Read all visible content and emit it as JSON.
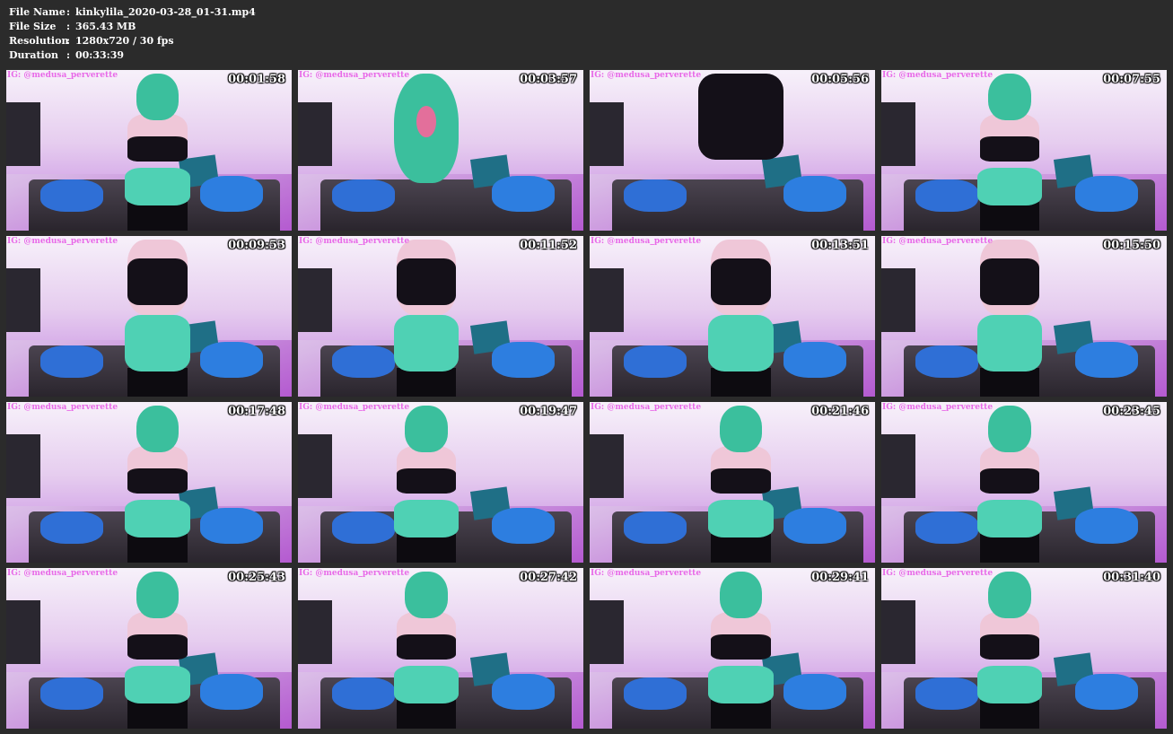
{
  "file_info": {
    "file_name_label": "File Name",
    "file_name": "kinkylila_2020-03-28_01-31.mp4",
    "file_size_label": "File Size",
    "file_size": "365.43 MB",
    "resolution_label": "Resolution",
    "resolution": "1280x720 / 30 fps",
    "duration_label": "Duration",
    "duration": "00:33:39",
    "separator": ":"
  },
  "watermark": "IG: @medusa_perverette",
  "colors": {
    "background": "#2b2b2b",
    "watermark": "#e86ae8",
    "timestamp": "#ffffff"
  },
  "thumbnails": [
    {
      "timestamp": "00:01:58"
    },
    {
      "timestamp": "00:03:57"
    },
    {
      "timestamp": "00:05:56"
    },
    {
      "timestamp": "00:07:55"
    },
    {
      "timestamp": "00:09:53"
    },
    {
      "timestamp": "00:11:52"
    },
    {
      "timestamp": "00:13:51"
    },
    {
      "timestamp": "00:15:50"
    },
    {
      "timestamp": "00:17:48"
    },
    {
      "timestamp": "00:19:47"
    },
    {
      "timestamp": "00:21:46"
    },
    {
      "timestamp": "00:23:45"
    },
    {
      "timestamp": "00:25:43"
    },
    {
      "timestamp": "00:27:42"
    },
    {
      "timestamp": "00:29:41"
    },
    {
      "timestamp": "00:31:40"
    }
  ]
}
